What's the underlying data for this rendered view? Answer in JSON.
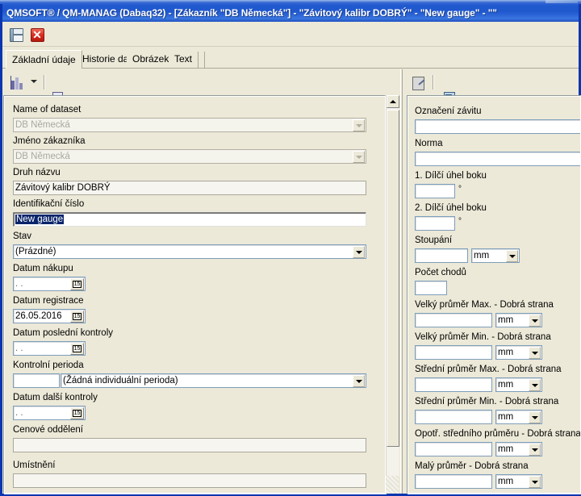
{
  "window": {
    "title": "QMSOFT® / QM-MANAG (Dabaq32) - [Zákazník \"DB Německá\"] - \"Závitový kalibr DOBRÝ\" - \"New gauge\" - \"\"",
    "accent_color": "#1f57cd",
    "face_color": "#ece9d8"
  },
  "toolbar_top": {
    "save_icon": "save-icon",
    "close_icon": "close-icon"
  },
  "tabs": [
    {
      "label": "Základní údaje",
      "active": true
    },
    {
      "label": "Historie dat",
      "active": false
    },
    {
      "label": "Obrázek",
      "active": false
    },
    {
      "label": "Text",
      "active": false
    }
  ],
  "left_toolbar": {
    "items": [
      {
        "icon": "chart-bars-icon",
        "name": "statistics-button"
      },
      {
        "icon": "chevron-down-icon",
        "name": "statistics-dropdown"
      },
      {
        "icon": "copy-pages-icon",
        "name": "copy-button"
      },
      {
        "icon": "gauge-icon",
        "name": "gauge-button"
      }
    ]
  },
  "right_toolbar": {
    "items": [
      {
        "icon": "document-edit-icon",
        "name": "edit-document-button"
      },
      {
        "icon": "database-list-icon",
        "name": "database-button"
      },
      {
        "icon": "insert-sigma-icon",
        "name": "insert-button"
      },
      {
        "icon": "color-blocks-icon",
        "name": "properties-button"
      }
    ]
  },
  "left_panel": {
    "fields": [
      {
        "label": "Name of dataset",
        "value": "DB Německá",
        "type": "combo",
        "disabled": true
      },
      {
        "label": "Jméno zákazníka",
        "value": "DB Německá",
        "type": "combo",
        "disabled": true
      },
      {
        "label": "Druh názvu",
        "value": "Závitový kalibr DOBRÝ",
        "type": "flat"
      },
      {
        "label": "Identifikační číslo",
        "value": "New gauge",
        "type": "text",
        "selected": true
      },
      {
        "label": "Stav",
        "value": "(Prázdné)",
        "type": "combo"
      },
      {
        "label": "Datum nákupu",
        "value": " .  .",
        "type": "date"
      },
      {
        "label": "Datum registrace",
        "value": "26.05.2016",
        "type": "date"
      },
      {
        "label": "Datum poslední kontroly",
        "value": " .  .",
        "type": "date"
      },
      {
        "label": "Kontrolní perioda",
        "value": "",
        "value2": "(Žádná individuální perioda)",
        "type": "period"
      },
      {
        "label": "Datum další kontroly",
        "value": " .  .",
        "type": "date"
      },
      {
        "label": "Cenové oddělení",
        "value": "",
        "type": "flat"
      },
      {
        "label": "Umístnění",
        "value": "",
        "type": "flat"
      }
    ],
    "scrollbar": {
      "name": "left-panel-scrollbar"
    }
  },
  "right_panel": {
    "fields": [
      {
        "label": "Označení závitu",
        "value": "",
        "type": "text"
      },
      {
        "label": "Norma",
        "value": "",
        "type": "text"
      },
      {
        "label": "1. Dílčí úhel boku",
        "value": "",
        "type": "small",
        "suffix": "°"
      },
      {
        "label": "2. Dílčí úhel boku",
        "value": "",
        "type": "small",
        "suffix": "°"
      },
      {
        "label": "Stoupání",
        "value": "",
        "type": "unit",
        "unit": "mm"
      },
      {
        "label": "Počet chodů",
        "value": "",
        "type": "tiny"
      },
      {
        "label": "Velký průměr Max. - Dobrá strana",
        "value": "",
        "type": "unit",
        "unit": "mm"
      },
      {
        "label": "Velký průměr Min. - Dobrá strana",
        "value": "",
        "type": "unit",
        "unit": "mm"
      },
      {
        "label": "Střední průměr Max. - Dobrá strana",
        "value": "",
        "type": "unit",
        "unit": "mm"
      },
      {
        "label": "Střední průměr Min. - Dobrá strana",
        "value": "",
        "type": "unit",
        "unit": "mm"
      },
      {
        "label": "Opotř. středního průměru - Dobrá strana",
        "value": "",
        "type": "unit",
        "unit": "mm"
      },
      {
        "label": "Malý průměr - Dobrá strana",
        "value": "",
        "type": "unit",
        "unit": "mm"
      }
    ]
  }
}
